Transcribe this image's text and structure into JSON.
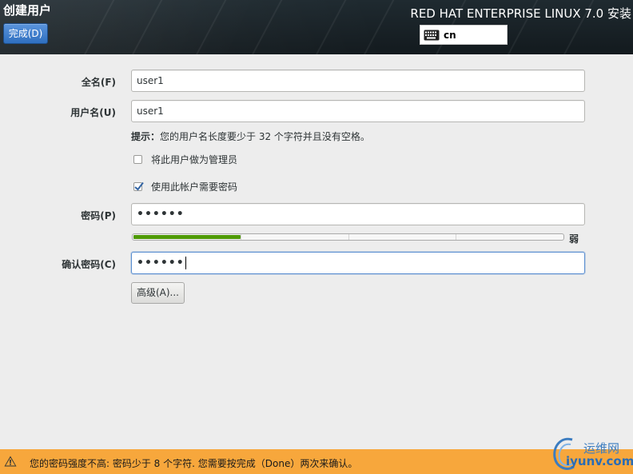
{
  "header": {
    "title": "创建用户",
    "done_label": "完成(D)",
    "product": "RED HAT ENTERPRISE LINUX 7.0 安装",
    "keyboard_layout": "cn"
  },
  "form": {
    "fullname_label": "全名(F)",
    "fullname_value": "user1",
    "username_label": "用户名(U)",
    "username_value": "user1",
    "hint_prefix": "提示：",
    "hint_text": "您的用户名长度要少于 32 个字符并且没有空格。",
    "admin_checkbox_label": "将此用户做为管理员",
    "admin_checked": false,
    "require_password_label": "使用此帐户需要密码",
    "require_password_checked": true,
    "password_label": "密码(P)",
    "password_value": "••••••",
    "strength_label": "弱",
    "strength_level": 0.25,
    "confirm_label": "确认密码(C)",
    "confirm_value": "••••••",
    "advanced_label": "高级(A)..."
  },
  "warning": {
    "text": "您的密码强度不高: 密码少于 8 个字符. 您需要按完成（Done）两次来确认。"
  },
  "watermark": {
    "line1": "运维网",
    "line2": "iyunv.com"
  },
  "colors": {
    "accent": "#2f6fbf",
    "warning": "#f7a73c",
    "strength": "#4e9a06"
  }
}
